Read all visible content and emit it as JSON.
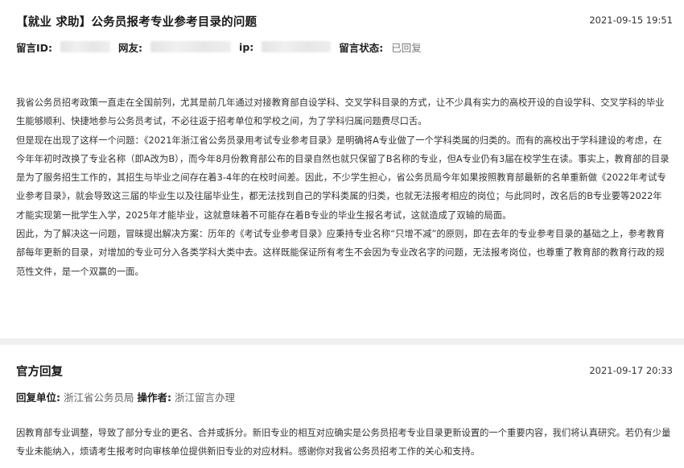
{
  "message": {
    "title": "【就业 求助】公务员报考专业参考目录的问题",
    "date": "2021-09-15 19:51",
    "meta": {
      "id_label": "留言ID:",
      "user_label": "网友:",
      "ip_label": "ip:",
      "status_label": "留言状态:",
      "status_value": "已回复"
    },
    "paragraphs": [
      "我省公务员招考政策一直走在全国前列，尤其是前几年通过对接教育部自设学科、交叉学科目录的方式，让不少具有实力的高校开设的自设学科、交叉学科的毕业生能够顺利、快捷地参与公务员考试，不必往返于招考单位和学校之间，为了学科归属问题费尽口舌。",
      "但是现在出现了这样一个问题：《2021年浙江省公务员录用考试专业参考目录》是明确将A专业做了一个学科类属的归类的。而有的高校出于学科建设的考虑，在今年年初时改换了专业名称（即A改为B），而今年8月份教育部公布的目录自然也就只保留了B名称的专业，但A专业仍有3届在校学生在读。事实上，教育部的目录是为了服务招生工作的，其招生与毕业之间存在着3-4年的在校时间差。因此，不少学生担心，省公务员局今年如果按照教育部最新的名单重新做《2022年考试专业参考目录》，就会导致这三届的毕业生以及往届毕业生，都无法找到自己的学科类属的归类，也就无法报考相应的岗位；与此同时，改名后的B专业要等2022年才能实现第一批学生入学，2025年才能毕业，这就意味着不可能存在着B专业的毕业生报名考试，这就造成了双输的局面。",
      "因此，为了解决这一问题，冒昧提出解决方案：历年的《考试专业参考目录》应秉持专业名称“只增不减”的原则，即在去年的专业参考目录的基础之上，参考教育部每年更新的目录，对增加的专业可分入各类学科大类中去。这样既能保证所有考生不会因为专业改名字的问题，无法报考岗位，也尊重了教育部的教育行政的规范性文件，是一个双赢的一面。"
    ]
  },
  "reply": {
    "title": "官方回复",
    "date": "2021-09-17 20:33",
    "unit_label": "回复单位:",
    "unit_value": "浙江省公务员局",
    "operator_label": "操作者:",
    "operator_value": "浙江留言办理",
    "paragraphs": [
      "因教育部专业调整，导致了部分专业的更名、合并或拆分。新旧专业的相互对应确实是公务员招考专业目录更新设置的一个重要内容，我们将认真研究。若仍有少量专业未能纳入，烦请考生报考时向审核单位提供新旧专业的对应材料。感谢你对我省公务员招考工作的关心和支持。"
    ]
  }
}
